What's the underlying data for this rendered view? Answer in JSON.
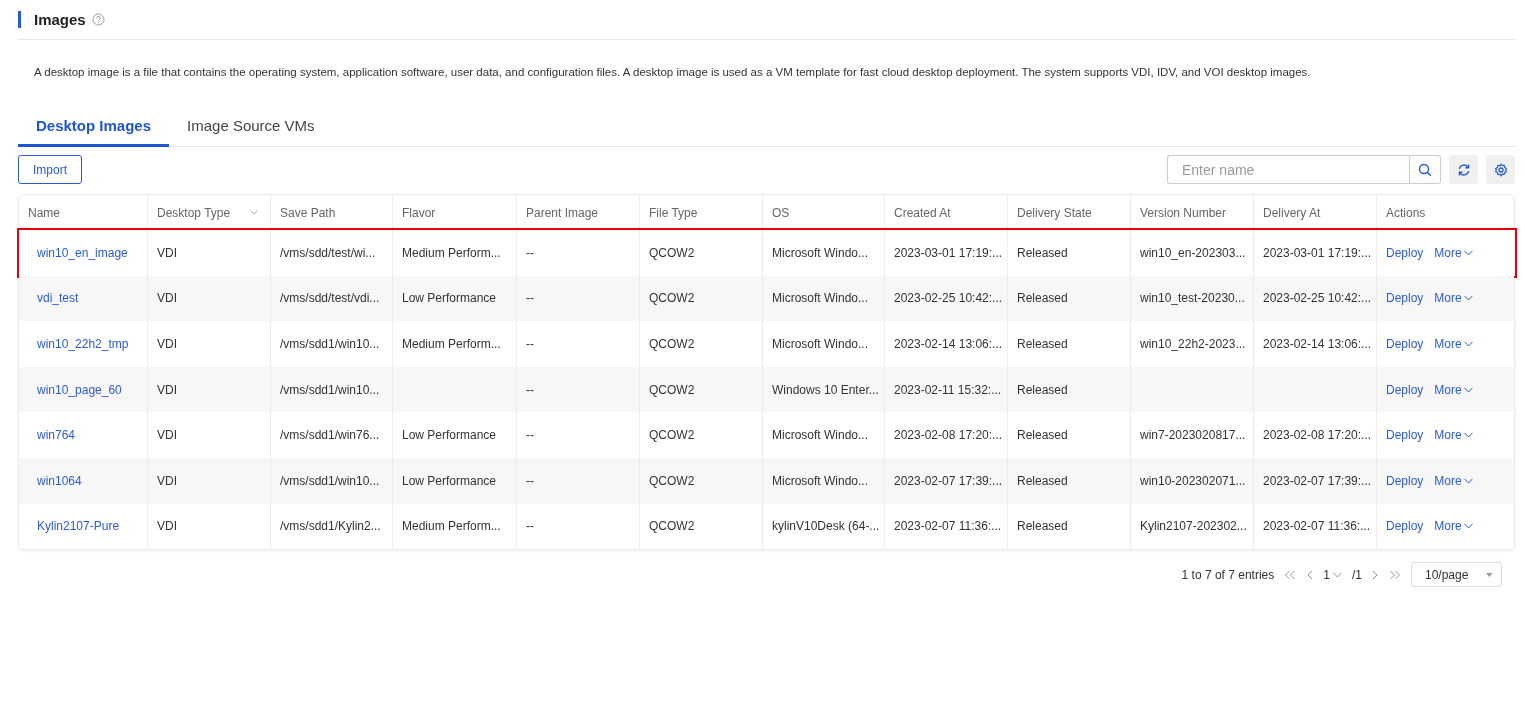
{
  "page": {
    "title": "Images",
    "description": "A desktop image is a file that contains the operating system, application software, user data, and configuration files. A desktop image is used as a VM template for fast cloud desktop deployment. The system supports VDI, IDV, and VOI desktop images."
  },
  "tabs": [
    {
      "label": "Desktop Images",
      "selected": true
    },
    {
      "label": "Image Source VMs",
      "selected": false
    }
  ],
  "toolbar": {
    "import_button": "Import",
    "search": {
      "placeholder": "Enter name"
    }
  },
  "table": {
    "columns": [
      {
        "label": "Name",
        "filter": false
      },
      {
        "label": "Desktop Type",
        "filter": true
      },
      {
        "label": "Save Path",
        "filter": false
      },
      {
        "label": "Flavor",
        "filter": false
      },
      {
        "label": "Parent Image",
        "filter": false
      },
      {
        "label": "File Type",
        "filter": false
      },
      {
        "label": "OS",
        "filter": false
      },
      {
        "label": "Created At",
        "filter": false
      },
      {
        "label": "Delivery State",
        "filter": false
      },
      {
        "label": "Version Number",
        "filter": false
      },
      {
        "label": "Delivery At",
        "filter": false
      },
      {
        "label": "Actions",
        "filter": false
      }
    ],
    "rows": [
      {
        "highlighted": true,
        "cells": [
          "win10_en_image",
          "VDI",
          "/vms/sdd/test/wi...",
          "Medium Perform...",
          "--",
          "QCOW2",
          "Microsoft Windo...",
          "2023-03-01 17:19:...",
          "Released",
          "win10_en-202303...",
          "2023-03-01 17:19:..."
        ],
        "actions": [
          "Deploy",
          "More"
        ]
      },
      {
        "highlighted": false,
        "cells": [
          "vdi_test",
          "VDI",
          "/vms/sdd/test/vdi...",
          "Low Performance",
          "--",
          "QCOW2",
          "Microsoft Windo...",
          "2023-02-25 10:42:...",
          "Released",
          "win10_test-20230...",
          "2023-02-25 10:42:..."
        ],
        "actions": [
          "Deploy",
          "More"
        ]
      },
      {
        "highlighted": false,
        "cells": [
          "win10_22h2_tmp",
          "VDI",
          "/vms/sdd1/win10...",
          "Medium Perform...",
          "--",
          "QCOW2",
          "Microsoft Windo...",
          "2023-02-14 13:06:...",
          "Released",
          "win10_22h2-2023...",
          "2023-02-14 13:06:..."
        ],
        "actions": [
          "Deploy",
          "More"
        ]
      },
      {
        "highlighted": false,
        "cells": [
          "win10_page_60",
          "VDI",
          "/vms/sdd1/win10...",
          "",
          "--",
          "QCOW2",
          "Windows 10 Enter...",
          "2023-02-11 15:32:...",
          "Released",
          "",
          ""
        ],
        "actions": [
          "Deploy",
          "More"
        ]
      },
      {
        "highlighted": false,
        "cells": [
          "win764",
          "VDI",
          "/vms/sdd1/win76...",
          "Low Performance",
          "--",
          "QCOW2",
          "Microsoft Windo...",
          "2023-02-08 17:20:...",
          "Released",
          "win7-2023020817...",
          "2023-02-08 17:20:..."
        ],
        "actions": [
          "Deploy",
          "More"
        ]
      },
      {
        "highlighted": false,
        "cells": [
          "win1064",
          "VDI",
          "/vms/sdd1/win10...",
          "Low Performance",
          "--",
          "QCOW2",
          "Microsoft Windo...",
          "2023-02-07 17:39:...",
          "Released",
          "win10-202302071...",
          "2023-02-07 17:39:..."
        ],
        "actions": [
          "Deploy",
          "More"
        ]
      },
      {
        "highlighted": false,
        "cells": [
          "Kylin2107-Pure",
          "VDI",
          "/vms/sdd1/Kylin2...",
          "Medium Perform...",
          "--",
          "QCOW2",
          "kylinV10Desk (64-...",
          "2023-02-07 11:36:...",
          "Released",
          "Kylin2107-202302...",
          "2023-02-07 11:36:..."
        ],
        "actions": [
          "Deploy",
          "More"
        ]
      }
    ]
  },
  "pagination": {
    "summary": "1 to 7 of 7 entries",
    "page": "1",
    "total": "/1",
    "page_size": "10/page"
  }
}
